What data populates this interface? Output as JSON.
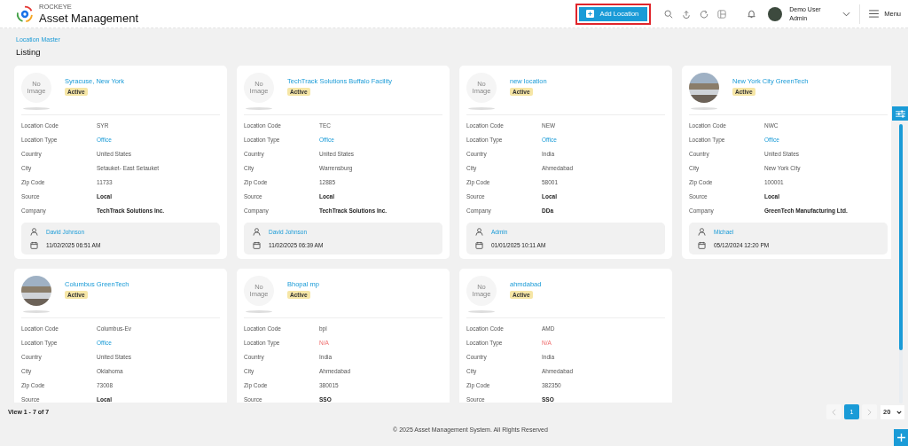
{
  "header": {
    "brand_small": "ROCKEYE",
    "brand": "Asset Management",
    "add_button": {
      "label": "Add Location",
      "highlighted": true
    },
    "user": {
      "name": "Demo User",
      "role": "Admin"
    },
    "menu_label": "Menu"
  },
  "breadcrumb": "Location Master",
  "page_title": "Listing",
  "cards": [
    {
      "name": "Syracuse, New York",
      "status": "Active",
      "image": {
        "kind": "none",
        "text": "No Image"
      },
      "fields": [
        {
          "label": "Location Code",
          "value": "SYR",
          "kind": "plain"
        },
        {
          "label": "Location Type",
          "value": "Office",
          "kind": "link"
        },
        {
          "label": "Country",
          "value": "United States",
          "kind": "plain"
        },
        {
          "label": "City",
          "value": "Setauket- East Setauket",
          "kind": "plain"
        },
        {
          "label": "Zip Code",
          "value": "11733",
          "kind": "plain"
        },
        {
          "label": "Source",
          "value": "Local",
          "kind": "bold"
        },
        {
          "label": "Company",
          "value": "TechTrack Solutions Inc.",
          "kind": "bold"
        }
      ],
      "user": "David Johnson",
      "date": "11/02/2025 06:51 AM"
    },
    {
      "name": "TechTrack Solutions Buffalo Facility",
      "status": "Active",
      "image": {
        "kind": "none",
        "text": "No Image"
      },
      "fields": [
        {
          "label": "Location Code",
          "value": "TEC",
          "kind": "plain"
        },
        {
          "label": "Location Type",
          "value": "Office",
          "kind": "link"
        },
        {
          "label": "Country",
          "value": "United States",
          "kind": "plain"
        },
        {
          "label": "City",
          "value": "Warrensburg",
          "kind": "plain"
        },
        {
          "label": "Zip Code",
          "value": "12885",
          "kind": "plain"
        },
        {
          "label": "Source",
          "value": "Local",
          "kind": "bold"
        },
        {
          "label": "Company",
          "value": "TechTrack Solutions Inc.",
          "kind": "bold"
        }
      ],
      "user": "David Johnson",
      "date": "11/02/2025 06:39 AM"
    },
    {
      "name": "new location",
      "status": "Active",
      "image": {
        "kind": "none",
        "text": "No Image"
      },
      "fields": [
        {
          "label": "Location Code",
          "value": "NEW",
          "kind": "plain"
        },
        {
          "label": "Location Type",
          "value": "Office",
          "kind": "link"
        },
        {
          "label": "Country",
          "value": "India",
          "kind": "plain"
        },
        {
          "label": "City",
          "value": "Ahmedabad",
          "kind": "plain"
        },
        {
          "label": "Zip Code",
          "value": "58001",
          "kind": "plain"
        },
        {
          "label": "Source",
          "value": "Local",
          "kind": "bold"
        },
        {
          "label": "Company",
          "value": "DDa",
          "kind": "bold"
        }
      ],
      "user": "Admin",
      "date": "01/01/2025 10:11 AM"
    },
    {
      "name": "New York City GreenTech",
      "status": "Active",
      "image": {
        "kind": "photo"
      },
      "fields": [
        {
          "label": "Location Code",
          "value": "NWC",
          "kind": "plain"
        },
        {
          "label": "Location Type",
          "value": "Office",
          "kind": "link"
        },
        {
          "label": "Country",
          "value": "United States",
          "kind": "plain"
        },
        {
          "label": "City",
          "value": "New York City",
          "kind": "plain"
        },
        {
          "label": "Zip Code",
          "value": "100001",
          "kind": "plain"
        },
        {
          "label": "Source",
          "value": "Local",
          "kind": "bold"
        },
        {
          "label": "Company",
          "value": "GreenTech Manufacturing Ltd.",
          "kind": "bold"
        }
      ],
      "user": "Michael",
      "date": "05/12/2024 12:20 PM"
    },
    {
      "name": "Columbus GreenTech",
      "status": "Active",
      "image": {
        "kind": "photo"
      },
      "fields": [
        {
          "label": "Location Code",
          "value": "Columbus-Ev",
          "kind": "plain"
        },
        {
          "label": "Location Type",
          "value": "Office",
          "kind": "link"
        },
        {
          "label": "Country",
          "value": "United States",
          "kind": "plain"
        },
        {
          "label": "City",
          "value": "Oklahoma",
          "kind": "plain"
        },
        {
          "label": "Zip Code",
          "value": "73008",
          "kind": "plain"
        },
        {
          "label": "Source",
          "value": "Local",
          "kind": "bold"
        }
      ]
    },
    {
      "name": "Bhopal mp",
      "status": "Active",
      "image": {
        "kind": "none",
        "text": "No Image"
      },
      "fields": [
        {
          "label": "Location Code",
          "value": "bpl",
          "kind": "plain"
        },
        {
          "label": "Location Type",
          "value": "N/A",
          "kind": "missing"
        },
        {
          "label": "Country",
          "value": "India",
          "kind": "plain"
        },
        {
          "label": "City",
          "value": "Ahmedabad",
          "kind": "plain"
        },
        {
          "label": "Zip Code",
          "value": "380015",
          "kind": "plain"
        },
        {
          "label": "Source",
          "value": "SSO",
          "kind": "bold"
        }
      ]
    },
    {
      "name": "ahmdabad",
      "status": "Active",
      "image": {
        "kind": "none",
        "text": "No Image"
      },
      "fields": [
        {
          "label": "Location Code",
          "value": "AMD",
          "kind": "plain"
        },
        {
          "label": "Location Type",
          "value": "N/A",
          "kind": "missing"
        },
        {
          "label": "Country",
          "value": "India",
          "kind": "plain"
        },
        {
          "label": "City",
          "value": "Ahmedabad",
          "kind": "plain"
        },
        {
          "label": "Zip Code",
          "value": "382350",
          "kind": "plain"
        },
        {
          "label": "Source",
          "value": "SSO",
          "kind": "bold"
        }
      ]
    }
  ],
  "footer": {
    "view_count": "View 1 - 7 of 7",
    "pages": [
      {
        "label": "1",
        "selected": true
      }
    ],
    "page_size": "20",
    "copyright": "© 2025 Asset Management System. All Rights Reserved"
  }
}
